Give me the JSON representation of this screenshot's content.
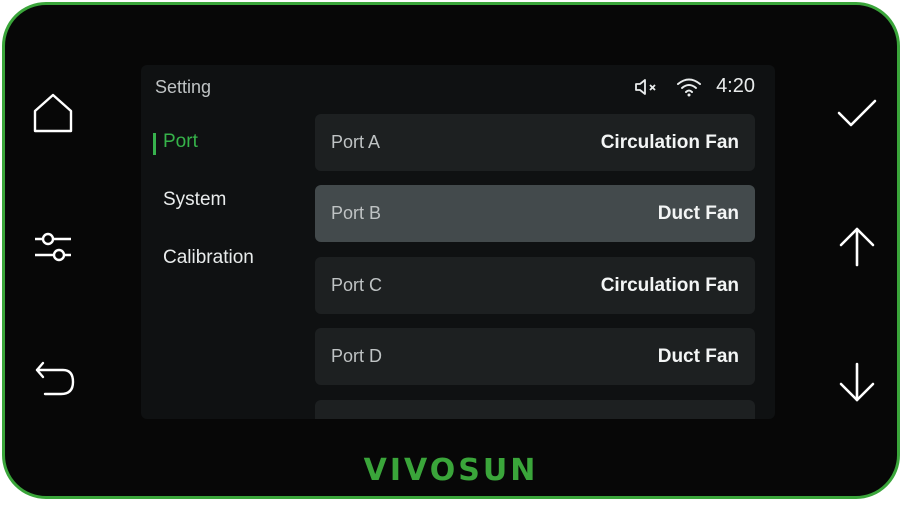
{
  "screen": {
    "title": "Setting",
    "status": {
      "mute_icon": "mute-speaker-icon",
      "wifi_icon": "wifi-icon",
      "time": "4:20"
    },
    "sidebar": {
      "items": [
        {
          "label": "Port",
          "active": true
        },
        {
          "label": "System",
          "active": false
        },
        {
          "label": "Calibration",
          "active": false
        }
      ]
    },
    "ports": [
      {
        "port": "Port A",
        "device": "Circulation Fan",
        "selected": false
      },
      {
        "port": "Port B",
        "device": "Duct Fan",
        "selected": true
      },
      {
        "port": "Port C",
        "device": "Circulation Fan",
        "selected": false
      },
      {
        "port": "Port D",
        "device": "Duct Fan",
        "selected": false
      },
      {
        "port": "",
        "device": "",
        "selected": false
      }
    ]
  },
  "hardware_buttons": {
    "left": [
      "home-icon",
      "sliders-icon",
      "back-arrow-icon"
    ],
    "right": [
      "check-icon",
      "arrow-up-icon",
      "arrow-down-icon"
    ]
  },
  "brand": {
    "logo_text": "VIVOSUN",
    "accent": "#3aa53a",
    "frame_color": "#070707"
  }
}
